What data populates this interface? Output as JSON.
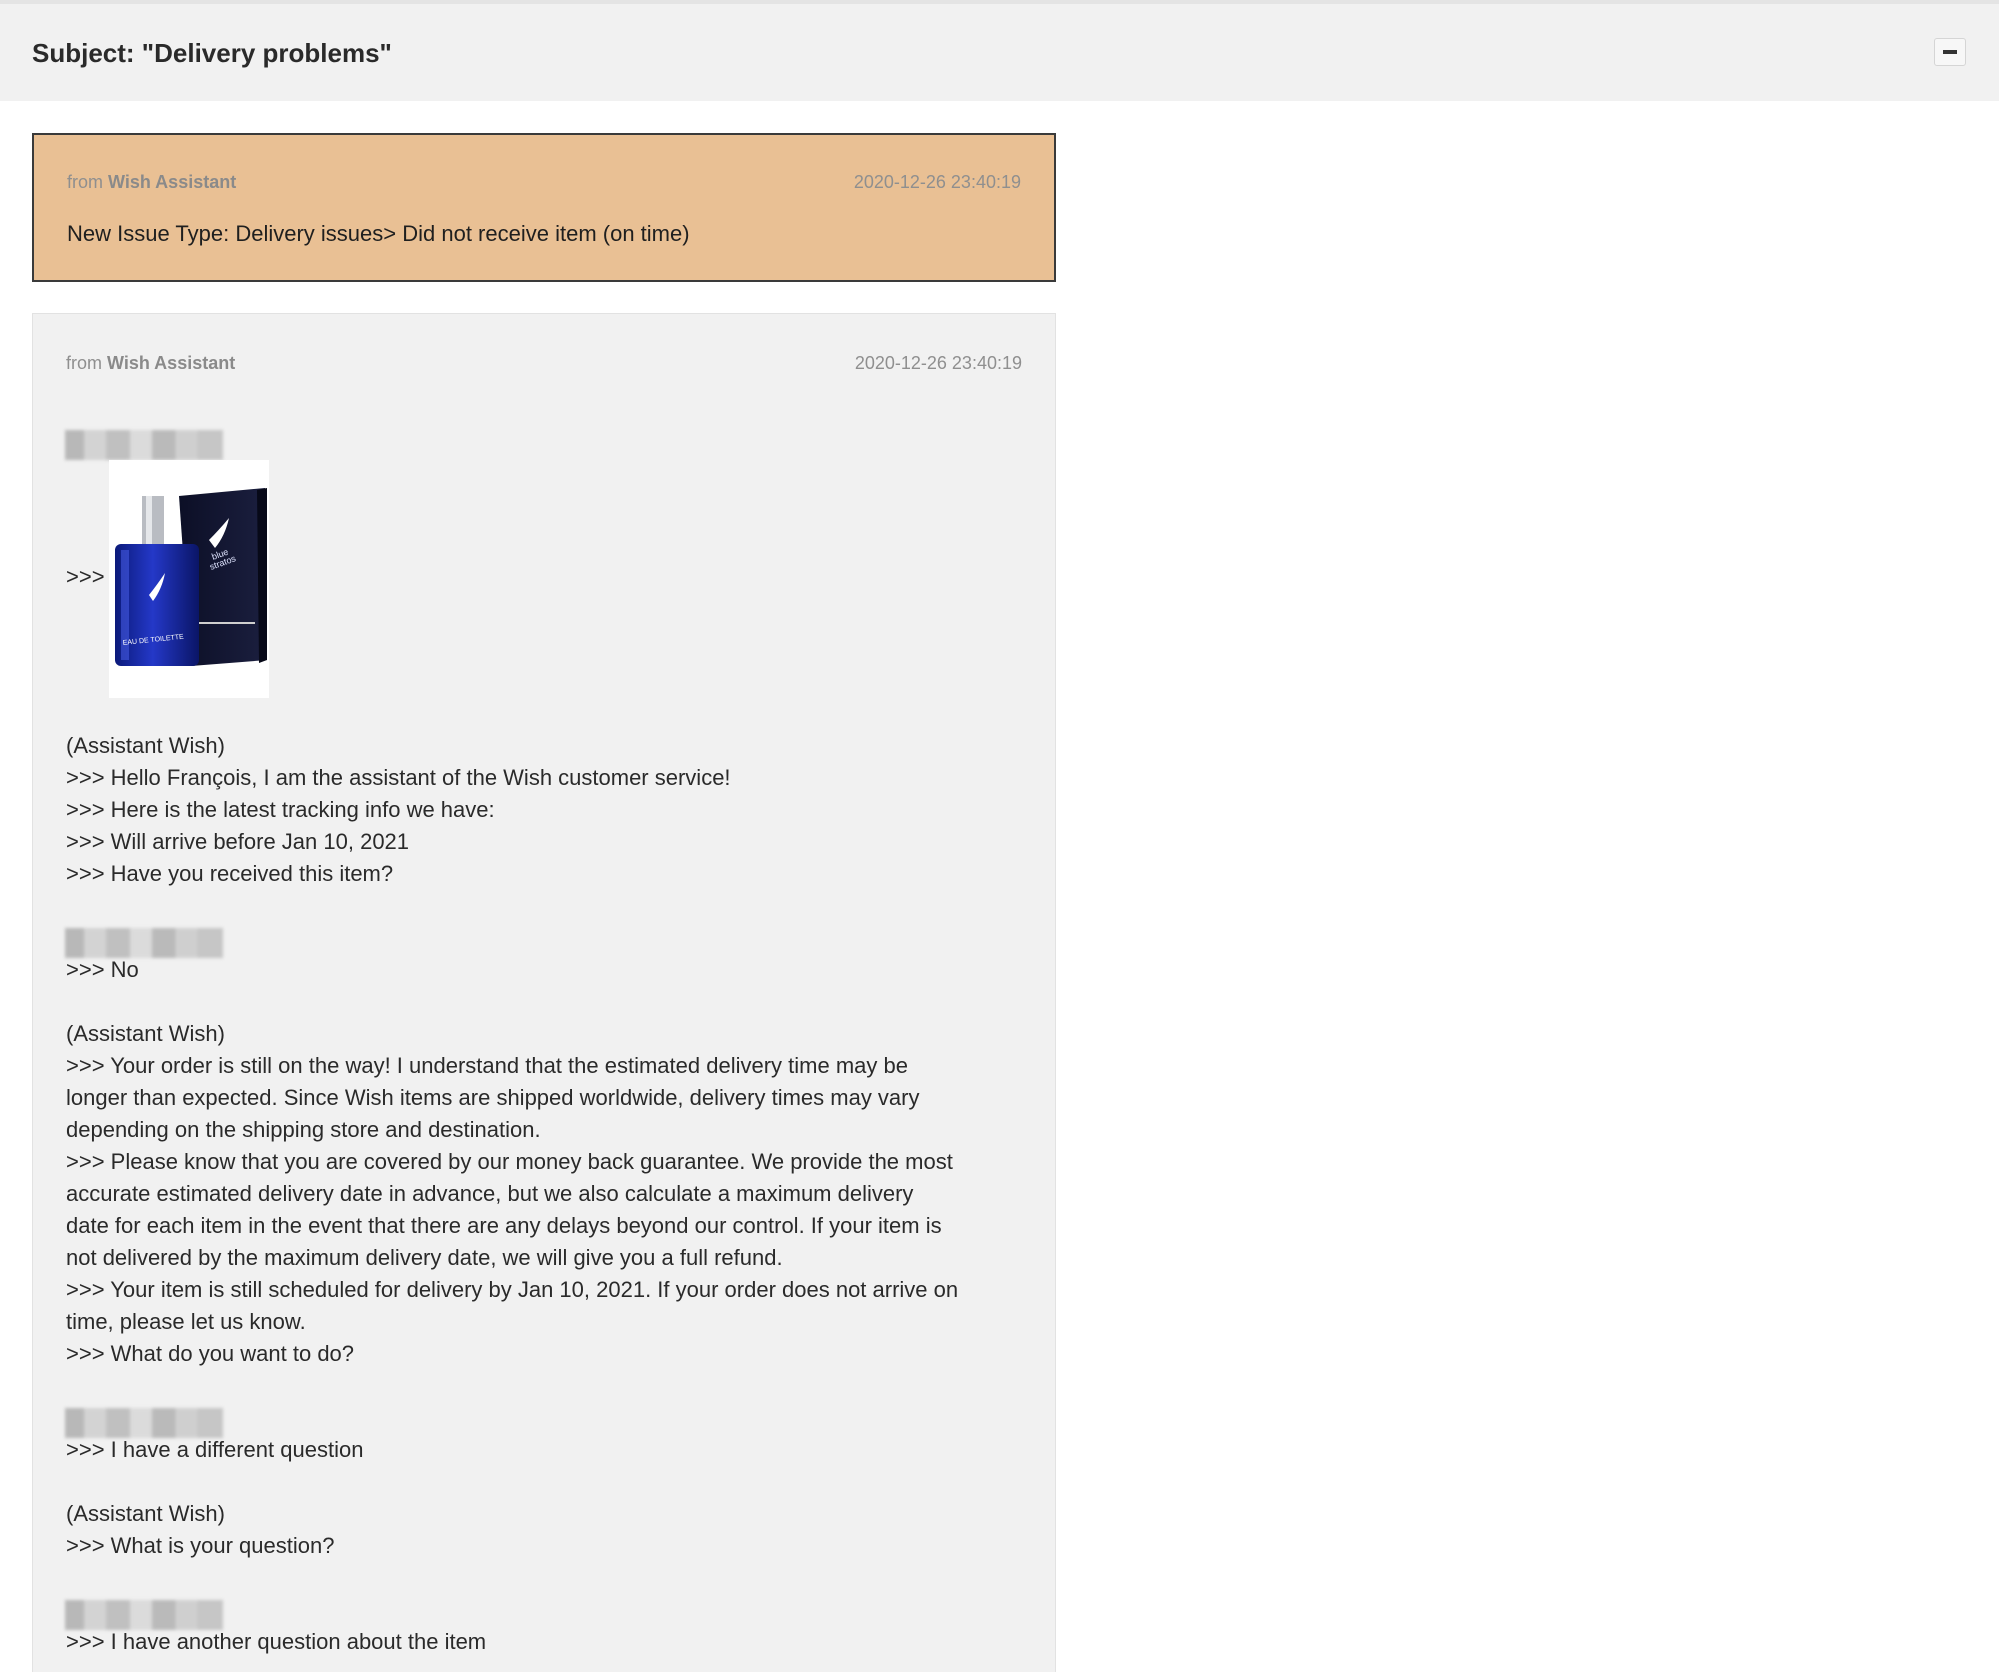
{
  "conversation": {
    "subject": "Subject: \"Delivery problems\"",
    "collapse_icon": "minus-icon"
  },
  "messages": [
    {
      "from_label": "from",
      "sender": "Wish Assistant",
      "timestamp": "2020-12-26 23:40:19",
      "body": "New Issue Type: Delivery issues> Did not receive item (on time)",
      "highlight_color": "#e9c094"
    },
    {
      "from_label": "from",
      "sender": "Wish Assistant",
      "timestamp": "2020-12-26 23:40:19",
      "image_prefix": ">>>",
      "product_image": "perfume-bottle-image",
      "lines": [
        "(Assistant Wish)",
        ">>> Hello François, I am the assistant of the Wish customer service!",
        ">>> Here is the latest tracking info we have:",
        ">>> Will arrive before Jan 10, 2021",
        ">>> Have you received this item?",
        ">>> No",
        "(Assistant Wish)",
        ">>> Your order is still on the way! I understand that the estimated delivery time may be",
        "longer than expected. Since Wish items are shipped worldwide, delivery times may vary",
        "depending on the shipping store and destination.",
        ">>> Please know that you are covered by our money back guarantee. We provide the most",
        "accurate estimated delivery date in advance, but we also calculate a maximum delivery",
        "date for each item in the event that there are any delays beyond our control. If your item is",
        "not delivered by the maximum delivery date, we will give you a full refund.",
        ">>> Your item is still scheduled for delivery by Jan 10, 2021. If your order does not arrive on",
        "time, please let us know.",
        ">>> What do you want to do?",
        ">>> I have a different question",
        "(Assistant Wish)",
        ">>> What is your question?",
        ">>> I have another question about the item"
      ]
    }
  ]
}
